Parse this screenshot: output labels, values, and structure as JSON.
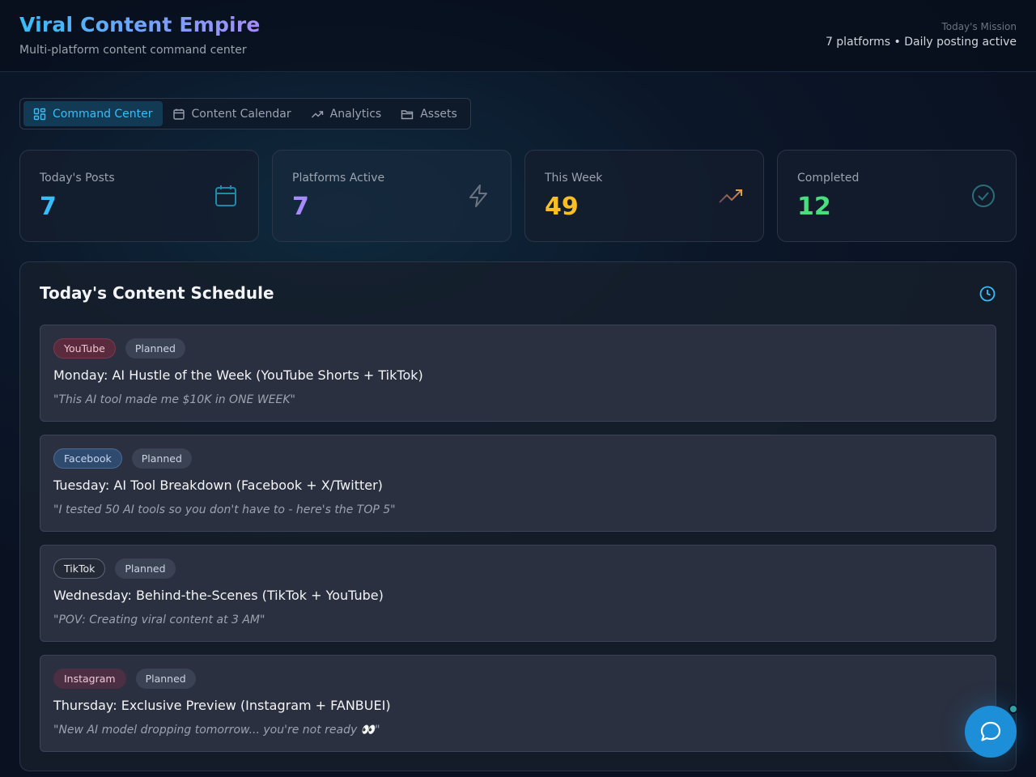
{
  "header": {
    "title": "Viral Content Empire",
    "subtitle": "Multi-platform content command center",
    "mission_label": "Today's Mission",
    "mission_value": "7 platforms • Daily posting active"
  },
  "tabs": [
    {
      "label": "Command Center",
      "icon": "grid-icon",
      "active": true
    },
    {
      "label": "Content Calendar",
      "icon": "calendar-icon",
      "active": false
    },
    {
      "label": "Analytics",
      "icon": "trending-up-icon",
      "active": false
    },
    {
      "label": "Assets",
      "icon": "folder-icon",
      "active": false
    }
  ],
  "stats": [
    {
      "label": "Today's Posts",
      "value": "7",
      "color": "#38bdf8",
      "icon": "calendar-icon"
    },
    {
      "label": "Platforms Active",
      "value": "7",
      "color": "#a78bfa",
      "icon": "lightning-icon"
    },
    {
      "label": "This Week",
      "value": "49",
      "color": "#fbbf24",
      "icon": "trending-up-icon"
    },
    {
      "label": "Completed",
      "value": "12",
      "color": "#4ade80",
      "icon": "check-circle-icon"
    }
  ],
  "schedule": {
    "title": "Today's Content Schedule",
    "items": [
      {
        "platform": "YouTube",
        "status": "Planned",
        "title": "Monday: AI Hustle of the Week (YouTube Shorts + TikTok)",
        "quote": "\"This AI tool made me $10K in ONE WEEK\""
      },
      {
        "platform": "Facebook",
        "status": "Planned",
        "title": "Tuesday: AI Tool Breakdown (Facebook + X/Twitter)",
        "quote": "\"I tested 50 AI tools so you don't have to - here's the TOP 5\""
      },
      {
        "platform": "TikTok",
        "status": "Planned",
        "title": "Wednesday: Behind-the-Scenes (TikTok + YouTube)",
        "quote": "\"POV: Creating viral content at 3 AM\""
      },
      {
        "platform": "Instagram",
        "status": "Planned",
        "title": "Thursday: Exclusive Preview (Instagram + FANBUEI)",
        "quote": "\"New AI model dropping tomorrow... you're not ready 👀\""
      }
    ]
  },
  "colors": {
    "accent": "#38bdf8",
    "chat_button": "#1d8fd8"
  }
}
